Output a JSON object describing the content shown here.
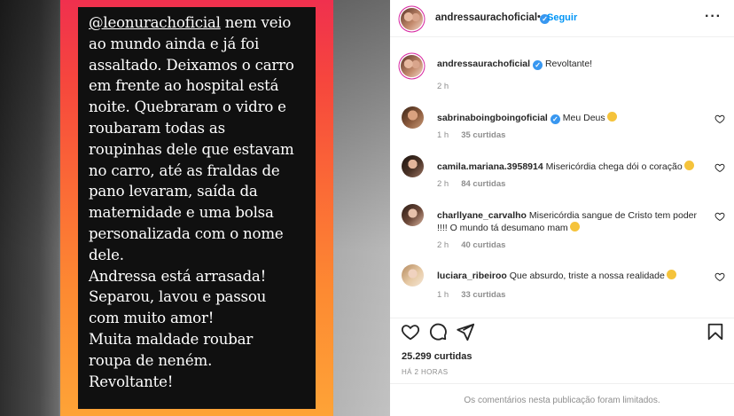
{
  "story": {
    "mention": "@leonurachoficial",
    "lines": [
      " nem veio",
      "ao mundo ainda e já foi",
      "assaltado. Deixamos o carro",
      "em frente ao hospital está",
      "noite. Quebraram o vidro e",
      "roubaram todas as",
      "roupinhas dele que estavam",
      "no carro, até as fraldas de",
      "pano levaram, saída da",
      "maternidade e uma bolsa",
      "personalizada com o nome",
      "dele.",
      "Andressa está arrasada!",
      "Separou, lavou e passou",
      "com muito amor!",
      "Muita maldade roubar",
      "roupa de neném.",
      "Revoltante!"
    ]
  },
  "header": {
    "username": "andressaurachoficial",
    "dot": "•",
    "follow_label": "Seguir",
    "more": "···"
  },
  "caption": {
    "username": "andressaurachoficial",
    "text": "Revoltante!",
    "time": "2 h"
  },
  "comments": [
    {
      "username": "sabrinaboingboingoficial",
      "verified": true,
      "text": "Meu Deus",
      "time": "1 h",
      "likes": "35 curtidas",
      "emoji": "worried-face"
    },
    {
      "username": "camila.mariana.3958914",
      "verified": false,
      "text": "Misericórdia chega dói o coração",
      "time": "2 h",
      "likes": "84 curtidas",
      "emoji": "crying-face"
    },
    {
      "username": "charllyane_carvalho",
      "verified": false,
      "text": "Misericórdia sangue de Cristo tem poder !!!! O mundo tá desumano mam",
      "time": "2 h",
      "likes": "40 curtidas",
      "emoji": "sad-face"
    },
    {
      "username": "luciara_ribeiroo",
      "verified": false,
      "text": "Que absurdo, triste a nossa realidade",
      "time": "1 h",
      "likes": "33 curtidas",
      "emoji": "sad-face"
    }
  ],
  "icons": {
    "like": "heart-icon",
    "comment": "comment-icon",
    "share": "share-icon",
    "save": "bookmark-icon"
  },
  "post": {
    "likes": "25.299 curtidas",
    "when": "HÁ 2 HORAS",
    "limited_notice": "Os comentários nesta publicação foram limitados."
  },
  "colors": {
    "accent_blue": "#0095f6",
    "verified_blue": "#3897f0",
    "muted_text": "#8e8e8e",
    "story_gradient_top": "#f0304e",
    "story_gradient_bottom": "#fea337"
  }
}
